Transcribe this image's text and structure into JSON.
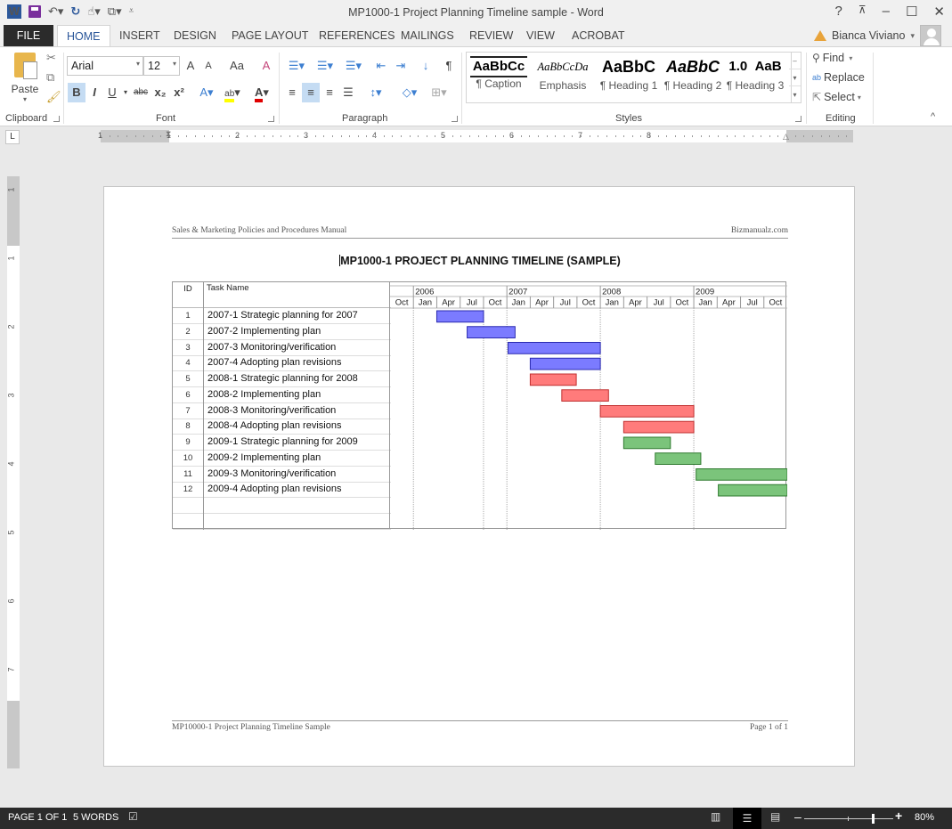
{
  "window": {
    "title": "MP1000-1 Project Planning Timeline sample - Word",
    "controls": [
      "?",
      "restore-ribbon",
      "minimize",
      "maximize",
      "close"
    ]
  },
  "quick_access": {
    "app_icon": "word-icon",
    "items": [
      "save-icon",
      "undo-icon",
      "redo-icon",
      "touch-mode-icon",
      "new-doc-icon",
      "customize-icon"
    ]
  },
  "tabs": [
    {
      "label": "FILE"
    },
    {
      "label": "HOME",
      "active": true
    },
    {
      "label": "INSERT"
    },
    {
      "label": "DESIGN"
    },
    {
      "label": "PAGE LAYOUT"
    },
    {
      "label": "REFERENCES"
    },
    {
      "label": "MAILINGS"
    },
    {
      "label": "REVIEW"
    },
    {
      "label": "VIEW"
    },
    {
      "label": "ACROBAT"
    }
  ],
  "user": {
    "name": "Bianca Viviano"
  },
  "ribbon": {
    "clipboard": {
      "paste_label": "Paste",
      "group_label": "Clipboard"
    },
    "font": {
      "font_name": "Arial",
      "font_size": "12",
      "group_label": "Font",
      "bold": "B",
      "italic": "I",
      "underline": "U",
      "strikethrough": "abc",
      "subscript": "x₂",
      "superscript": "x²",
      "grow": "A",
      "shrink": "A",
      "case": "Aa",
      "highlight_color": "#ffff00",
      "font_color": "#e00000"
    },
    "paragraph": {
      "group_label": "Paragraph",
      "pilcrow": "¶"
    },
    "styles": {
      "group_label": "Styles",
      "items": [
        {
          "sample": "AaBbCc",
          "name": "¶ Caption"
        },
        {
          "sample": "AaBbCcDa",
          "name": "Emphasis"
        },
        {
          "sample": "AaBbC",
          "name": "¶ Heading 1"
        },
        {
          "sample": "AaBbC",
          "name": "¶ Heading 2"
        },
        {
          "sample": "1.0",
          "name": "¶ Heading 3"
        },
        {
          "sample": "AaB",
          "name": ""
        }
      ]
    },
    "editing": {
      "group_label": "Editing",
      "find": "Find",
      "replace": "Replace",
      "select": "Select"
    }
  },
  "ruler": {
    "horizontal_numbers": [
      "1",
      "1",
      "2",
      "3",
      "4",
      "5",
      "6",
      "7",
      "8"
    ],
    "vertical_numbers": [
      "1",
      "1",
      "2",
      "3",
      "4",
      "5",
      "6",
      "7"
    ]
  },
  "document": {
    "header_left": "Sales & Marketing Policies and Procedures Manual",
    "header_right": "Bizmanualz.com",
    "title": "MP1000-1 PROJECT PLANNING TIMELINE (SAMPLE)",
    "footer_left": "MP10000-1 Project Planning Timeline Sample",
    "footer_right": "Page 1 of 1"
  },
  "gantt": {
    "id_header": "ID",
    "name_header": "Task Name",
    "years": [
      "2006",
      "2007",
      "2008",
      "2009"
    ],
    "quarters": [
      "Oct",
      "Jan",
      "Apr",
      "Jul",
      "Oct",
      "Jan",
      "Apr",
      "Jul",
      "Oct",
      "Jan",
      "Apr",
      "Jul",
      "Oct",
      "Jan",
      "Apr",
      "Jul",
      "Oct"
    ],
    "timeline_start": "2005-10",
    "timeline_quarters": 17,
    "colors": {
      "blue": "#7b7bff",
      "red": "#ff7b7b",
      "green": "#7bc47b"
    },
    "tasks": [
      {
        "id": "1",
        "name": "2007-1 Strategic planning for 2007",
        "start_q": 2.0,
        "end_q": 4.0,
        "color": "blue"
      },
      {
        "id": "2",
        "name": "2007-2 Implementing plan",
        "start_q": 3.3,
        "end_q": 5.35,
        "color": "blue"
      },
      {
        "id": "3",
        "name": "2007-3 Monitoring/verification",
        "start_q": 5.05,
        "end_q": 9.0,
        "color": "blue"
      },
      {
        "id": "4",
        "name": "2007-4 Adopting plan revisions",
        "start_q": 6.0,
        "end_q": 9.0,
        "color": "blue"
      },
      {
        "id": "5",
        "name": "2008-1 Strategic planning for 2008",
        "start_q": 6.0,
        "end_q": 7.97,
        "color": "red"
      },
      {
        "id": "6",
        "name": "2008-2 Implementing plan",
        "start_q": 7.35,
        "end_q": 9.35,
        "color": "red"
      },
      {
        "id": "7",
        "name": "2008-3 Monitoring/verification",
        "start_q": 9.0,
        "end_q": 13.0,
        "color": "red"
      },
      {
        "id": "8",
        "name": "2008-4 Adopting plan revisions",
        "start_q": 10.0,
        "end_q": 13.0,
        "color": "red"
      },
      {
        "id": "9",
        "name": "2009-1 Strategic planning for 2009",
        "start_q": 10.0,
        "end_q": 12.0,
        "color": "green"
      },
      {
        "id": "10",
        "name": "2009-2 Implementing plan",
        "start_q": 11.35,
        "end_q": 13.3,
        "color": "green"
      },
      {
        "id": "11",
        "name": "2009-3 Monitoring/verification",
        "start_q": 13.1,
        "end_q": 17.0,
        "color": "green"
      },
      {
        "id": "12",
        "name": "2009-4 Adopting plan revisions",
        "start_q": 14.05,
        "end_q": 17.0,
        "color": "green"
      }
    ],
    "empty_rows": 2
  },
  "statusbar": {
    "page": "PAGE 1 OF 1",
    "words": "5 WORDS",
    "zoom": "80%",
    "zoom_level": 0.8
  }
}
